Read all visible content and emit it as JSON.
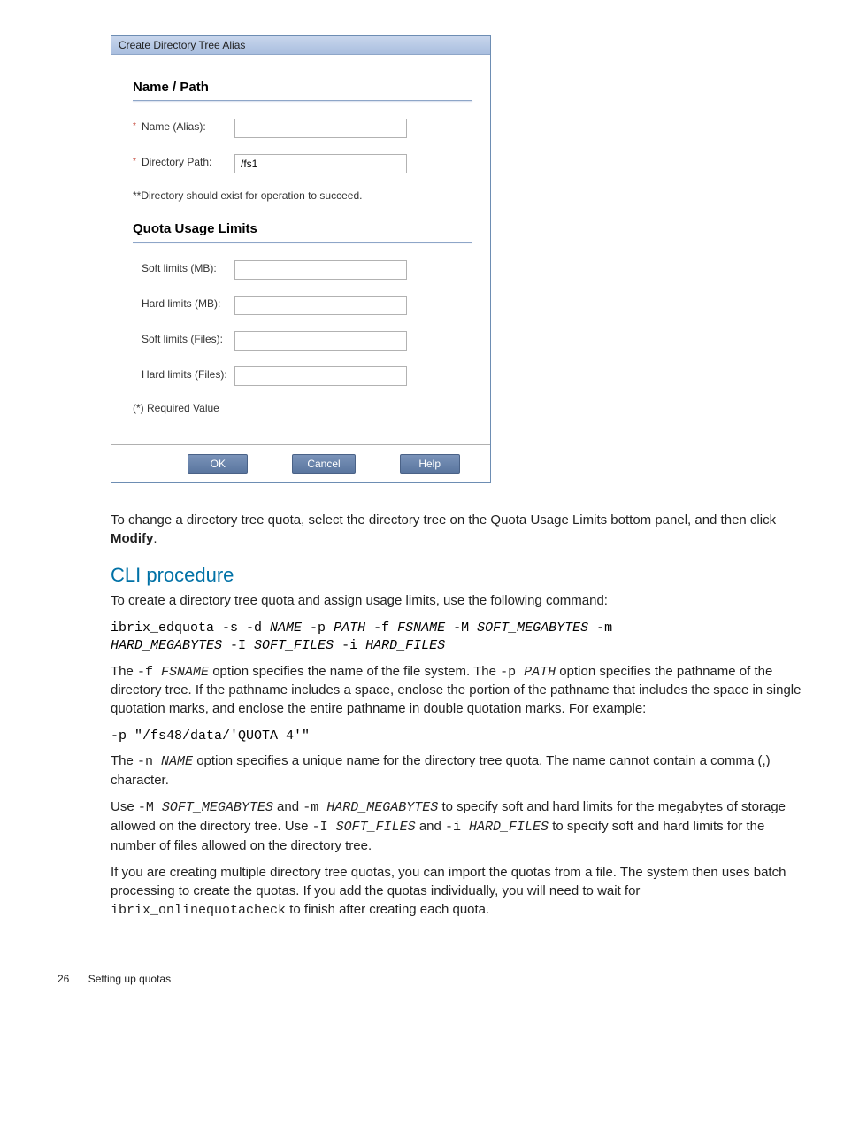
{
  "dialog": {
    "title": "Create Directory Tree Alias",
    "name_path_heading": "Name / Path",
    "name_label": "Name (Alias):",
    "name_value": "",
    "path_label": "Directory Path:",
    "path_value": "/fs1",
    "hint": "**Directory should exist for operation to succeed.",
    "quota_heading": "Quota Usage Limits",
    "soft_mb_label": "Soft limits (MB):",
    "soft_mb_value": "",
    "hard_mb_label": "Hard limits (MB):",
    "hard_mb_value": "",
    "soft_files_label": "Soft limits (Files):",
    "soft_files_value": "",
    "hard_files_label": "Hard limits (Files):",
    "hard_files_value": "",
    "required_note": "(*) Required Value",
    "ok": "OK",
    "cancel": "Cancel",
    "help": "Help"
  },
  "para1a": "To change a directory tree quota, select the directory tree on the Quota Usage Limits bottom panel, and then click ",
  "para1b": "Modify",
  "para1c": ".",
  "cli_heading": "CLI procedure",
  "para2": "To create a directory tree quota and assign usage limits, use the following command:",
  "cmd1_parts": [
    {
      "t": "ibrix_edquota -s -d ",
      "v": false
    },
    {
      "t": "NAME",
      "v": true
    },
    {
      "t": " -p ",
      "v": false
    },
    {
      "t": "PATH",
      "v": true
    },
    {
      "t": " -f ",
      "v": false
    },
    {
      "t": "FSNAME",
      "v": true
    },
    {
      "t": " -M ",
      "v": false
    },
    {
      "t": "SOFT_MEGABYTES",
      "v": true
    },
    {
      "t": " -m\n",
      "v": false
    },
    {
      "t": "HARD_MEGABYTES",
      "v": true
    },
    {
      "t": " -I ",
      "v": false
    },
    {
      "t": "SOFT_FILES",
      "v": true
    },
    {
      "t": " -i ",
      "v": false
    },
    {
      "t": "HARD_FILES",
      "v": true
    }
  ],
  "para3_runs": [
    {
      "t": "The ",
      "c": "body"
    },
    {
      "t": "-f ",
      "c": "code"
    },
    {
      "t": "FSNAME",
      "c": "var"
    },
    {
      "t": " option specifies the name of the file system. The ",
      "c": "body"
    },
    {
      "t": "-p ",
      "c": "code"
    },
    {
      "t": "PATH",
      "c": "var"
    },
    {
      "t": " option specifies the pathname of the directory tree. If the pathname includes a space, enclose the portion of the pathname that includes the space in single quotation marks, and enclose the entire pathname in double quotation marks. For example:",
      "c": "body"
    }
  ],
  "cmd2": "-p \"/fs48/data/'QUOTA 4'\"",
  "para4_runs": [
    {
      "t": "The ",
      "c": "body"
    },
    {
      "t": "-n ",
      "c": "code"
    },
    {
      "t": "NAME",
      "c": "var"
    },
    {
      "t": " option specifies a unique name for the directory tree quota. The name cannot contain a comma (,) character.",
      "c": "body"
    }
  ],
  "para5_runs": [
    {
      "t": "Use ",
      "c": "body"
    },
    {
      "t": "-M ",
      "c": "code"
    },
    {
      "t": "SOFT_MEGABYTES",
      "c": "var"
    },
    {
      "t": " and ",
      "c": "body"
    },
    {
      "t": "-m ",
      "c": "code"
    },
    {
      "t": "HARD_MEGABYTES",
      "c": "var"
    },
    {
      "t": " to specify soft and hard limits for the megabytes of storage allowed on the directory tree. Use ",
      "c": "body"
    },
    {
      "t": "-I ",
      "c": "code"
    },
    {
      "t": "SOFT_FILES",
      "c": "var"
    },
    {
      "t": " and ",
      "c": "body"
    },
    {
      "t": "-i ",
      "c": "code"
    },
    {
      "t": "HARD_FILES",
      "c": "var"
    },
    {
      "t": " to specify soft and hard limits for the number of files allowed on the directory tree.",
      "c": "body"
    }
  ],
  "para6_runs": [
    {
      "t": "If you are creating multiple directory tree quotas, you can import the quotas from a file. The system then uses batch processing to create the quotas. If you add the quotas individually, you will need to wait for ",
      "c": "body"
    },
    {
      "t": "ibrix_onlinequotacheck",
      "c": "code"
    },
    {
      "t": " to finish after creating each quota.",
      "c": "body"
    }
  ],
  "footer": {
    "page": "26",
    "section": "Setting up quotas"
  }
}
